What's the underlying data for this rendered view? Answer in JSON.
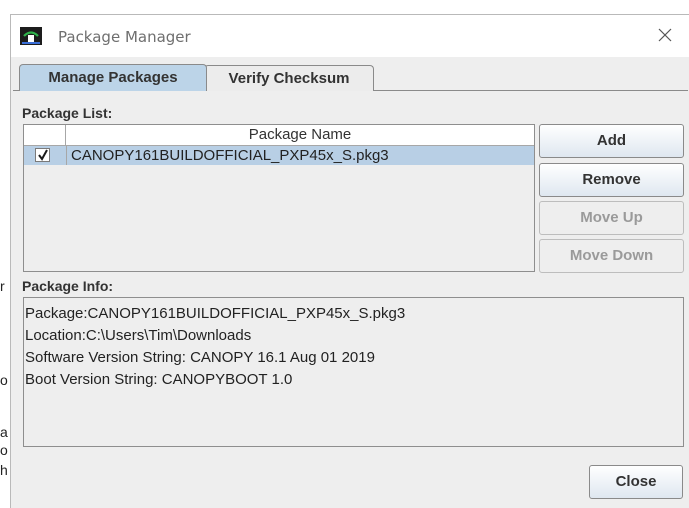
{
  "window": {
    "title": "Package Manager"
  },
  "tabs": [
    {
      "label": "Manage Packages",
      "active": true
    },
    {
      "label": "Verify Checksum",
      "active": false
    }
  ],
  "package_list": {
    "label": "Package List:",
    "column_header": "Package Name",
    "rows": [
      {
        "checked": true,
        "name": "CANOPY161BUILDOFFICIAL_PXP45x_S.pkg3",
        "selected": true
      }
    ]
  },
  "buttons": {
    "add": "Add",
    "remove": "Remove",
    "move_up": "Move Up",
    "move_down": "Move Down",
    "close": "Close"
  },
  "package_info": {
    "label": "Package Info:",
    "lines": [
      "Package:CANOPY161BUILDOFFICIAL_PXP45x_S.pkg3",
      "Location:C:\\Users\\Tim\\Downloads",
      "Software Version String: CANOPY 16.1 Aug 01 2019",
      "Boot Version String: CANOPYBOOT 1.0"
    ]
  },
  "background_fragments": [
    "r",
    "o",
    "a",
    "o",
    "h"
  ],
  "colors": {
    "selected_row": "#b8cfe5",
    "active_tab": "#bcd4e8",
    "disabled_text": "#9a9a9a"
  }
}
